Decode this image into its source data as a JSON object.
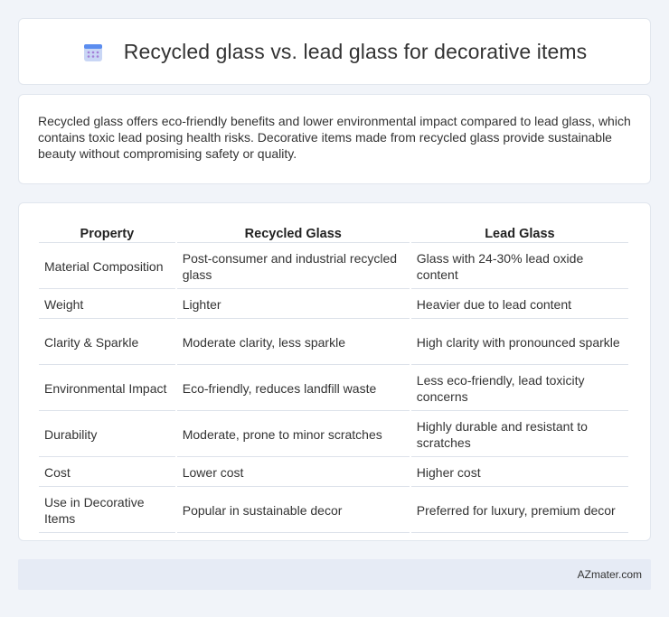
{
  "header": {
    "title": "Recycled glass vs. lead glass for decorative items",
    "icon": "calendar-icon",
    "icon_colors": {
      "top": "#5b8def",
      "body": "#c9d6f5",
      "dots": "#a47fd8"
    }
  },
  "intro": {
    "text": "Recycled glass offers eco-friendly benefits and lower environmental impact compared to lead glass, which contains toxic lead posing health risks. Decorative items made from recycled glass provide sustainable beauty without compromising safety or quality."
  },
  "table": {
    "headers": [
      "Property",
      "Recycled Glass",
      "Lead Glass"
    ],
    "rows": [
      [
        "Material Composition",
        "Post-consumer and industrial recycled glass",
        "Glass with 24-30% lead oxide content"
      ],
      [
        "Weight",
        "Lighter",
        "Heavier due to lead content"
      ],
      [
        "Clarity & Sparkle",
        "Moderate clarity, less sparkle",
        "High clarity with pronounced sparkle"
      ],
      [
        "Environmental Impact",
        "Eco-friendly, reduces landfill waste",
        "Less eco-friendly, lead toxicity concerns"
      ],
      [
        "Durability",
        "Moderate, prone to minor scratches",
        "Highly durable and resistant to scratches"
      ],
      [
        "Cost",
        "Lower cost",
        "Higher cost"
      ],
      [
        "Use in Decorative Items",
        "Popular in sustainable decor",
        "Preferred for luxury, premium decor"
      ]
    ]
  },
  "footer": {
    "text": "AZmater.com"
  }
}
